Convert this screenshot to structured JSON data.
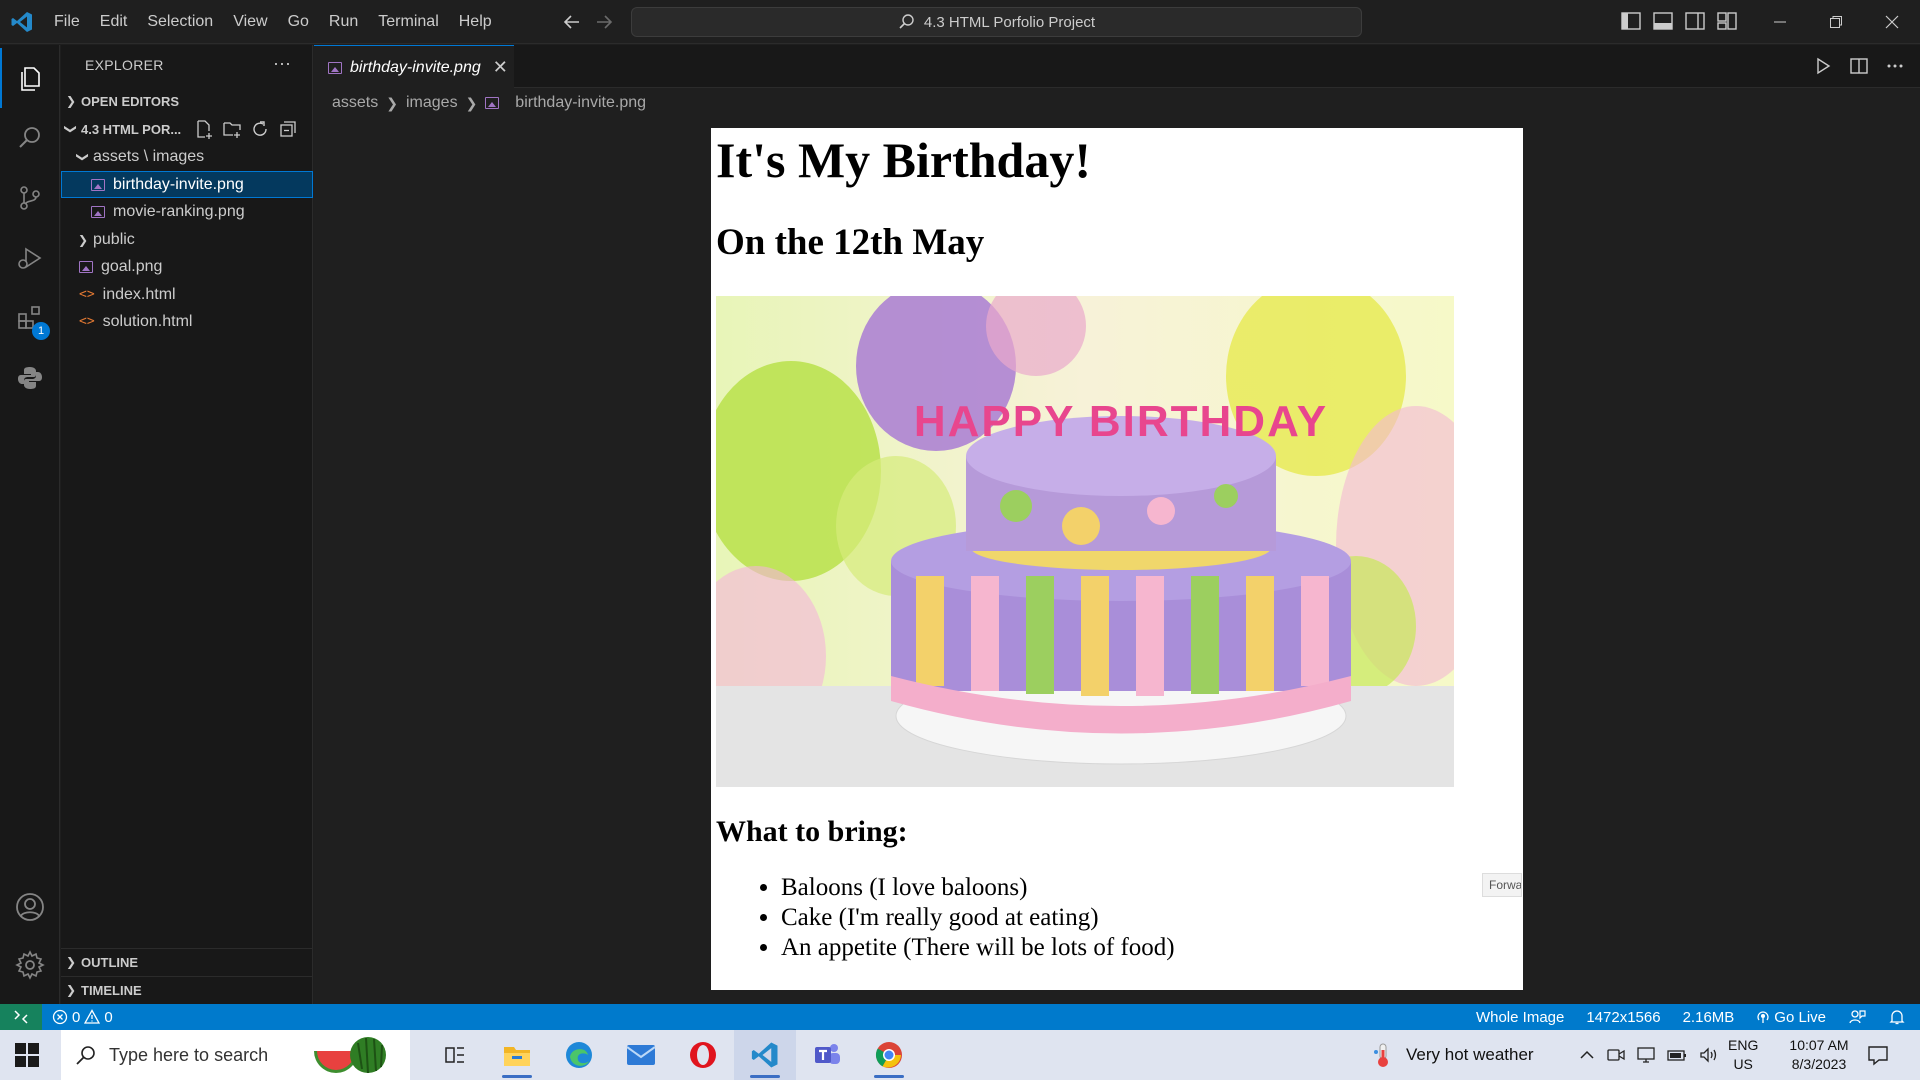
{
  "window": {
    "menu": [
      "File",
      "Edit",
      "Selection",
      "View",
      "Go",
      "Run",
      "Terminal",
      "Help"
    ],
    "command_center": "4.3 HTML Porfolio Project"
  },
  "activity_bar": {
    "extensions_badge": "1"
  },
  "sidebar": {
    "title": "EXPLORER",
    "more": "···",
    "open_editors": "OPEN EDITORS",
    "project": "4.3 HTML POR...",
    "folder_assets_images": "assets \\ images",
    "files": {
      "birthday": "birthday-invite.png",
      "movie": "movie-ranking.png",
      "public": "public",
      "goal": "goal.png",
      "index": "index.html",
      "solution": "solution.html"
    },
    "outline": "OUTLINE",
    "timeline": "TIMELINE"
  },
  "editor": {
    "tab_label": "birthday-invite.png",
    "breadcrumb": [
      "assets",
      "images",
      "birthday-invite.png"
    ]
  },
  "invite": {
    "title": "It's My Birthday!",
    "date": "On the 12th May",
    "what_heading": "What to bring:",
    "items": [
      "Baloons (I love baloons)",
      "Cake (I'm really good at eating)",
      "An appetite (There will be lots of food)"
    ],
    "cake_candles_text": "HAPPY BIRTHDAY"
  },
  "forward_tooltip": "Forwa",
  "statusbar": {
    "errors": "0",
    "warnings": "0",
    "mode": "Whole Image",
    "dimensions": "1472x1566",
    "size": "2.16MB",
    "go_live": "Go Live"
  },
  "taskbar": {
    "search_placeholder": "Type here to search",
    "weather": "Very hot weather",
    "lang_line1": "ENG",
    "lang_line2": "US",
    "time": "10:07 AM",
    "date": "8/3/2023"
  },
  "colors": {
    "accent": "#0078d4",
    "statusbar": "#007acc",
    "remote": "#16825d",
    "selected_row": "#04395e"
  }
}
